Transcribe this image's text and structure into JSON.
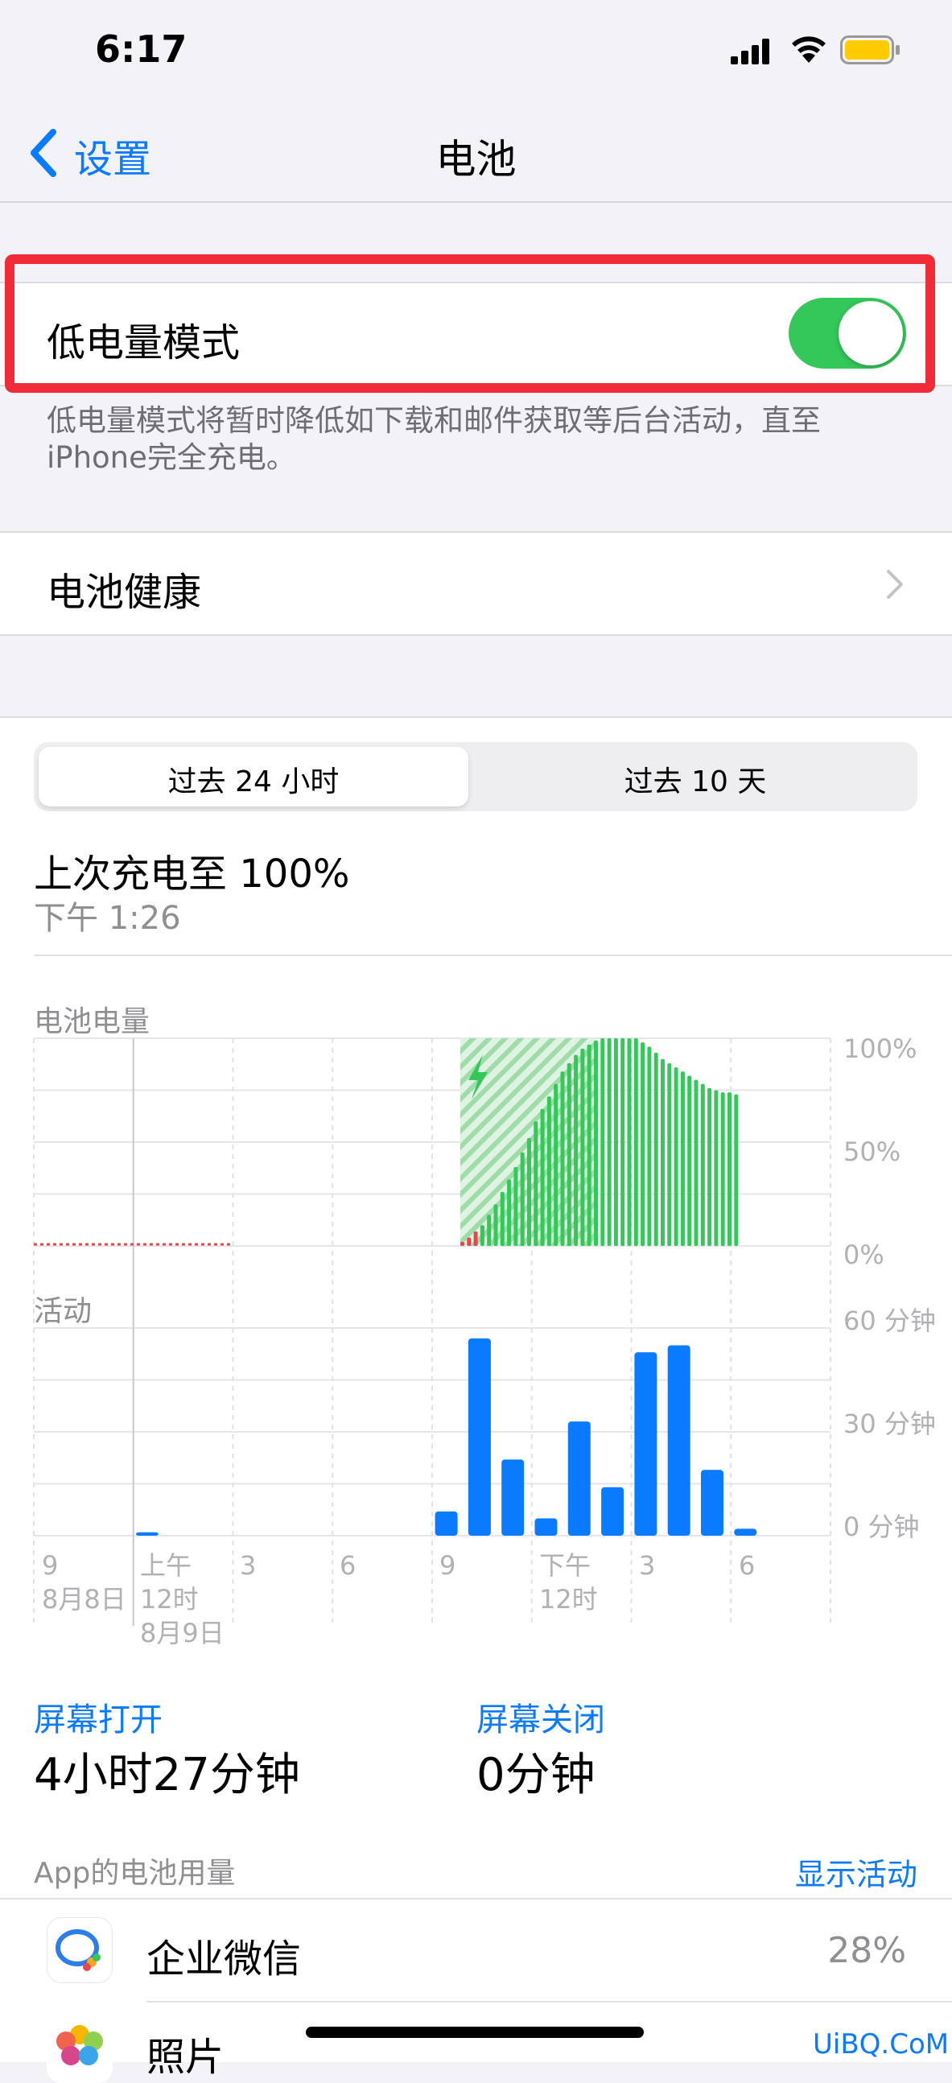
{
  "status_bar": {
    "time": "6:17"
  },
  "nav": {
    "back_label": "设置",
    "title": "电池"
  },
  "low_power": {
    "label": "低电量模式",
    "enabled": true,
    "footnote_line1": "低电量模式将暂时降低如下载和邮件获取等后台活动，直至",
    "footnote_line2": "iPhone完全充电。"
  },
  "battery_health": {
    "label": "电池健康"
  },
  "segments": {
    "tab1": "过去 24 小时",
    "tab2": "过去 10 天",
    "selected": "过去 24 小时"
  },
  "last_charge": {
    "title": "上次充电至 100%",
    "time": "下午 1:26"
  },
  "battery_chart": {
    "label": "电池电量",
    "y_ticks": [
      "100%",
      "50%",
      "0%"
    ]
  },
  "activity_chart": {
    "label": "活动",
    "y_ticks": [
      "60 分钟",
      "30 分钟",
      "0 分钟"
    ]
  },
  "x_axis": {
    "t1": "9",
    "t2": "上午",
    "t2b": "12时",
    "t3": "3",
    "t4": "6",
    "t5": "9",
    "t6": "下午",
    "t6b": "12时",
    "t7": "3",
    "t8": "6",
    "date1": "8月8日",
    "date2": "8月9日"
  },
  "screen": {
    "on_label": "屏幕打开",
    "on_value": "4小时27分钟",
    "off_label": "屏幕关闭",
    "off_value": "0分钟"
  },
  "app_usage": {
    "label": "App的电池用量",
    "show_activity": "显示活动",
    "apps": [
      {
        "name": "企业微信",
        "percent": "28%"
      },
      {
        "name": "照片",
        "percent": ""
      }
    ]
  },
  "watermark": "UiBQ.CoM",
  "chart_data": [
    {
      "type": "bar",
      "title": "电池电量",
      "ylim": [
        0,
        100
      ],
      "unit": "%",
      "charging_start_index": 13,
      "charging_end_index": 27,
      "low_values_red": [
        0,
        2,
        4,
        7,
        10
      ],
      "values": [
        0,
        0,
        0,
        0,
        0,
        0,
        0,
        0,
        0,
        0,
        0,
        0,
        0,
        2,
        4,
        7,
        10,
        15,
        20,
        26,
        32,
        38,
        45,
        52,
        60,
        66,
        72,
        78,
        84,
        88,
        92,
        95,
        97,
        99,
        100,
        100,
        100,
        100,
        100,
        100,
        98,
        96,
        93,
        90,
        88,
        86,
        84,
        82,
        80,
        78,
        76,
        75,
        74,
        74,
        73
      ]
    },
    {
      "type": "bar",
      "title": "活动",
      "ylim": [
        0,
        60
      ],
      "unit": "分钟",
      "values": [
        0,
        0,
        0,
        1,
        0,
        0,
        0,
        0,
        0,
        0,
        0,
        0,
        7,
        57,
        22,
        5,
        33,
        14,
        53,
        55,
        19,
        2
      ]
    }
  ]
}
